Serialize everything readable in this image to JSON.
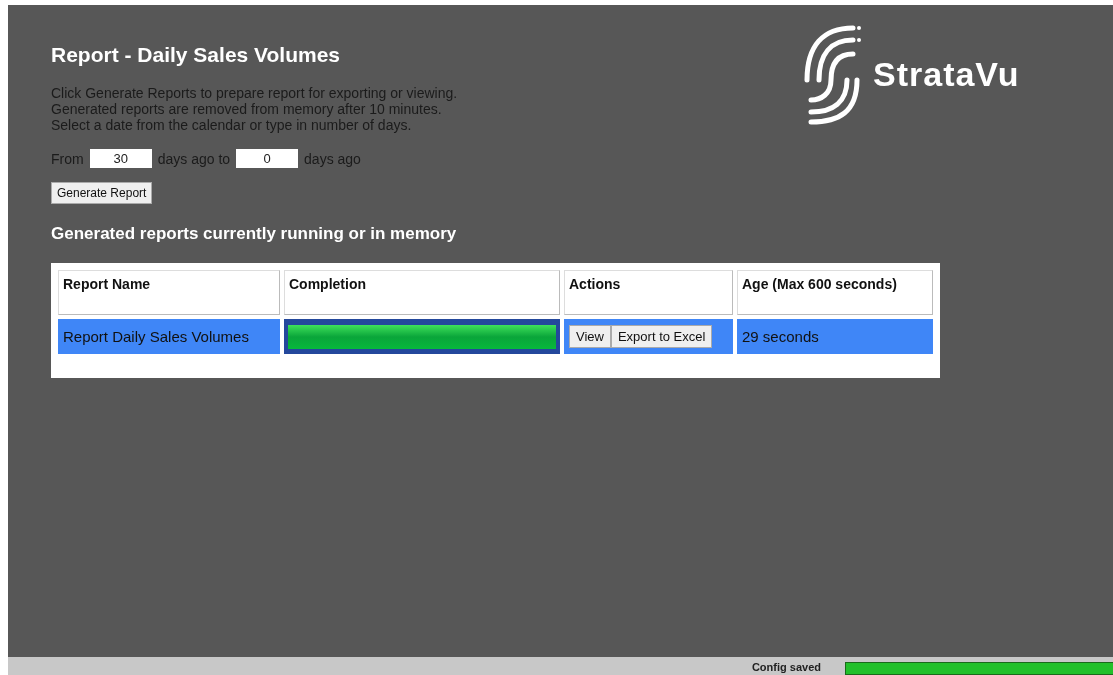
{
  "header": {
    "title": "Report - Daily Sales Volumes",
    "logo_text": "StrataVu"
  },
  "instructions": [
    "Click Generate Reports to prepare report for exporting or viewing.",
    "Generated reports are removed from memory after 10 minutes.",
    "Select a date from the calendar or type in number of days."
  ],
  "range": {
    "from_label": "From",
    "from_value": "30",
    "middle_label": "days ago to",
    "to_value": "0",
    "end_label": "days ago"
  },
  "generate_button": "Generate Report",
  "section_title": "Generated reports currently running or in memory",
  "table": {
    "columns": [
      "Report Name",
      "Completion",
      "Actions",
      "Age (Max 600 seconds)"
    ],
    "rows": [
      {
        "name": "Report Daily Sales Volumes",
        "level": 1,
        "actions": [
          "View",
          "Export to Excel"
        ],
        "age": "29 seconds"
      }
    ]
  },
  "status_bar": {
    "text": "Config saved"
  }
}
